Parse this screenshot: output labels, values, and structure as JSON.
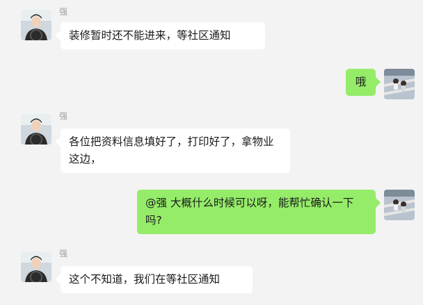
{
  "chat": {
    "messages": [
      {
        "sender": "强",
        "side": "left",
        "text": "装修暂时还不能进来，等社区通知"
      },
      {
        "side": "right",
        "text": "哦"
      },
      {
        "sender": "强",
        "side": "left",
        "text": "各位把资料信息填好了，打印好了，拿物业这边，"
      },
      {
        "side": "right",
        "text": "@强  大概什么时候可以呀，能帮忙确认一下吗?"
      },
      {
        "sender": "强",
        "side": "left",
        "text": "这个不知道，我们在等社区通知"
      }
    ]
  },
  "colors": {
    "background": "#f3f3f3",
    "incoming_bubble": "#ffffff",
    "outgoing_bubble": "#95ec69",
    "sender_name": "#9e9e9e"
  }
}
